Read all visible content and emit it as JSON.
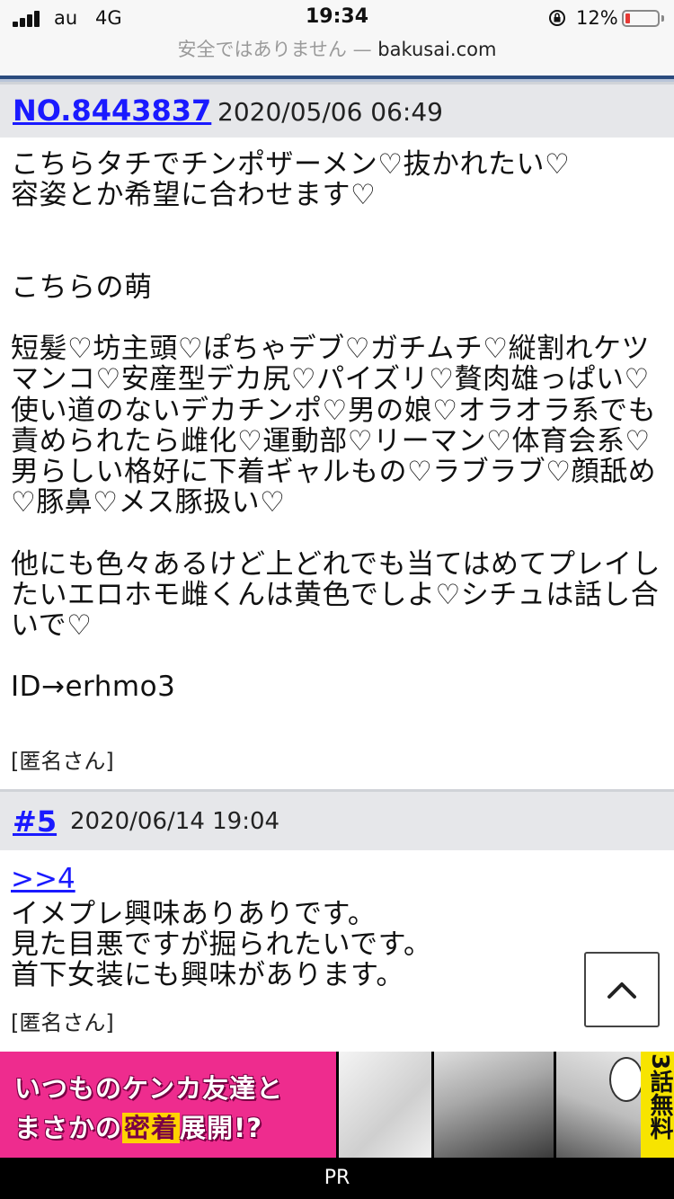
{
  "status_bar": {
    "carrier": "au",
    "network": "4G",
    "time": "19:34",
    "battery": "12%",
    "battery_level": 0.12,
    "battery_color": "#e53935"
  },
  "url_bar": {
    "warning": "安全ではありません —",
    "domain": "bakusai.com"
  },
  "posts": [
    {
      "number": "NO.8443837",
      "date": "2020/05/06 06:49",
      "body": "こちらタチでチンポザーメン♡抜かれたい♡\n容姿とか希望に合わせます♡\n\n\nこちらの萌\n\n短髪♡坊主頭♡ぽちゃデブ♡ガチムチ♡縦割れケツマンコ♡安産型デカ尻♡パイズリ♡贅肉雄っぱい♡使い道のないデカチンポ♡男の娘♡オラオラ系でも責められたら雌化♡運動部♡リーマン♡体育会系♡男らしい格好に下着ギャルもの♡ラブラブ♡顔舐め♡豚鼻♡メス豚扱い♡\n\n他にも色々あるけど上どれでも当てはめてプレイしたいエロホモ雌くんは黄色でしよ♡シチュは話し合いで♡\n\nID→erhmo3",
      "author": "[匿名さん]"
    },
    {
      "number": "#5",
      "date": "2020/06/14 19:04",
      "reply_to": ">>4",
      "body": "イメプレ興味ありありです。\n見た目悪ですが掘られたいです。\n首下女装にも興味があります。",
      "author": "[匿名さん]"
    }
  ],
  "scroll_top": {
    "icon": "chevron-up-icon"
  },
  "ad": {
    "line1": "いつものケンカ友達と",
    "line2_a": "まさかの",
    "line2_highlight": "密着",
    "line2_b": "展開!?",
    "badge": "3話無料",
    "accent": "#ee2c8e",
    "badge_color": "#f7e400"
  },
  "footer": {
    "pr": "PR"
  },
  "colors": {
    "link": "#1a1aff",
    "header_bg": "#e6e7ea",
    "rule": "#2b4c7e"
  }
}
